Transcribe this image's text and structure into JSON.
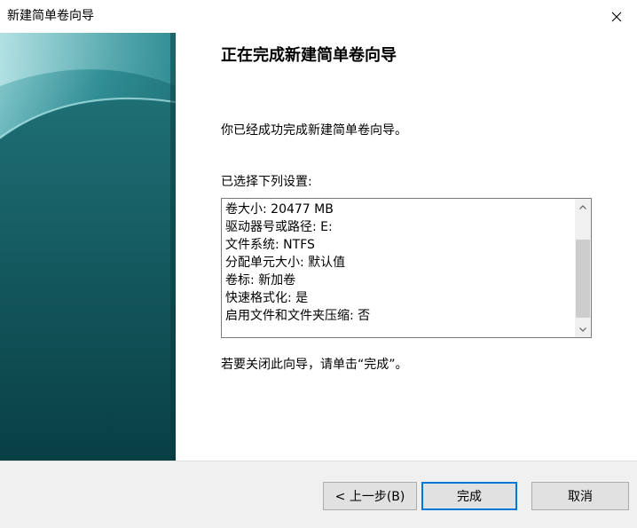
{
  "window": {
    "title": "新建简单卷向导",
    "close_icon": "close-icon"
  },
  "main": {
    "heading": "正在完成新建简单卷向导",
    "description": "你已经成功完成新建简单卷向导。",
    "settings_label": "已选择下列设置:",
    "settings": [
      "卷大小: 20477 MB",
      "驱动器号或路径: E:",
      "文件系统: NTFS",
      "分配单元大小: 默认值",
      "卷标: 新加卷",
      "快速格式化: 是",
      "启用文件和文件夹压缩: 否"
    ],
    "close_hint": "若要关闭此向导，请单击“完成”。"
  },
  "buttons": {
    "back_label": "< 上一步(B)",
    "finish_label": "完成",
    "cancel_label": "取消"
  },
  "colors": {
    "banner_dark": "#0a4d52",
    "banner_light": "#7cc3c8",
    "accent": "#0078d7"
  }
}
